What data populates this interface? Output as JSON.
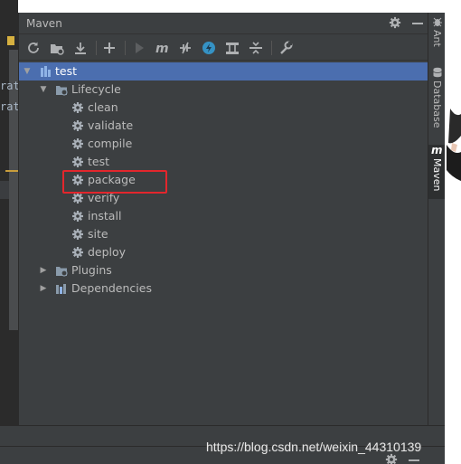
{
  "editor": {
    "code_lines": [
      "rat",
      "rat"
    ]
  },
  "panel": {
    "title": "Maven",
    "header_icons": [
      "gear-icon",
      "minimize-icon"
    ]
  },
  "toolbar": {
    "buttons": [
      {
        "name": "reload-icon",
        "glyph": "⟳"
      },
      {
        "name": "add-maven-projects-icon",
        "glyph": ""
      },
      {
        "name": "download-sources-icon",
        "glyph": "⤓"
      },
      {
        "name": "add-icon",
        "glyph": "+"
      },
      {
        "name": "run-icon",
        "glyph": "▶"
      },
      {
        "name": "execute-maven-goal-icon",
        "glyph": "m"
      },
      {
        "name": "toggle-offline-icon",
        "glyph": "⧸"
      },
      {
        "name": "skip-tests-icon",
        "glyph": "ϟ"
      },
      {
        "name": "show-dependencies-icon",
        "glyph": ""
      },
      {
        "name": "collapse-all-icon",
        "glyph": ""
      },
      {
        "name": "settings-wrench-icon",
        "glyph": ""
      }
    ]
  },
  "tree": {
    "project": "test",
    "lifecycle": "Lifecycle",
    "goals": [
      "clean",
      "validate",
      "compile",
      "test",
      "package",
      "verify",
      "install",
      "site",
      "deploy"
    ],
    "plugins": "Plugins",
    "dependencies": "Dependencies",
    "highlighted_goal": "package"
  },
  "right_strip": {
    "tabs": [
      {
        "label": "Ant",
        "icon": "ant-icon"
      },
      {
        "label": "Database",
        "icon": "database-icon"
      },
      {
        "label": "Maven",
        "icon": "maven-icon",
        "active": true
      }
    ]
  },
  "watermark": "https://blog.csdn.net/weixin_44310139",
  "colors": {
    "panel_bg": "#3c3f41",
    "selection": "#4b6eaf",
    "highlight_border": "#e3262c",
    "text": "#bbbbbb"
  }
}
